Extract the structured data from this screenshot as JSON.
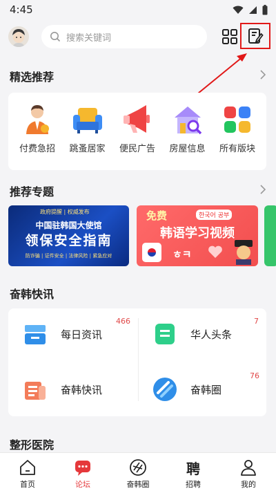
{
  "status_bar": {
    "time": "4:45"
  },
  "search": {
    "placeholder": "搜索关键词"
  },
  "featured": {
    "title": "精选推荐",
    "items": [
      {
        "label": "付费急招",
        "icon": "worker-icon"
      },
      {
        "label": "跳蚤居家",
        "icon": "sofa-icon"
      },
      {
        "label": "便民广告",
        "icon": "megaphone-icon"
      },
      {
        "label": "房屋信息",
        "icon": "house-search-icon"
      },
      {
        "label": "所有版块",
        "icon": "all-sections-icon"
      }
    ]
  },
  "topics": {
    "title": "推荐专题",
    "banner1": {
      "top_tag": "政府提醒 | 权威发布",
      "line1": "中国驻韩国大使馆",
      "line2": "领保安全指南",
      "tags": "防诈骗 | 证件安全 | 法律风险 | 紧急应对"
    },
    "banner2": {
      "badge": "免费",
      "tag": "한국어 공부",
      "title": "韩语学习视频",
      "hangul": "ㅎㅋ"
    }
  },
  "news": {
    "title": "奋韩快讯",
    "items": [
      {
        "label": "每日资讯",
        "count": "466"
      },
      {
        "label": "华人头条",
        "count": "7"
      },
      {
        "label": "奋韩快讯",
        "count": ""
      },
      {
        "label": "奋韩圈",
        "count": "76"
      }
    ]
  },
  "hospital": {
    "title": "整形医院"
  },
  "tabbar": [
    {
      "label": "首页"
    },
    {
      "label": "论坛"
    },
    {
      "label": "奋韩圈"
    },
    {
      "label": "招聘",
      "glyph": "聘"
    },
    {
      "label": "我的"
    }
  ],
  "colors": {
    "accent": "#e5383b",
    "highlight_border": "#e11818"
  }
}
